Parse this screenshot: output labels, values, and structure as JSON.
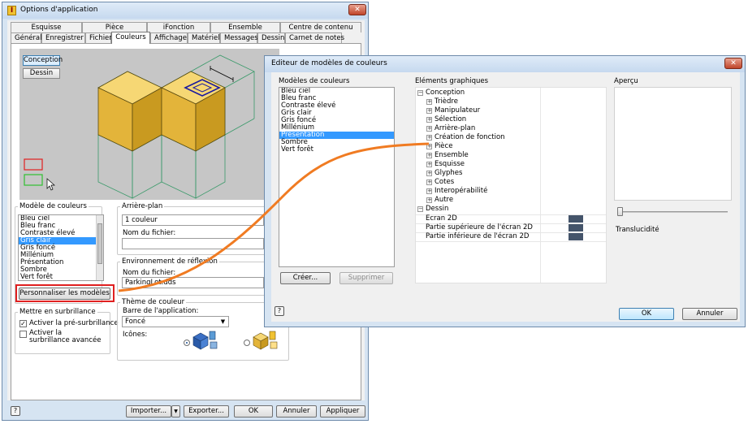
{
  "options": {
    "title": "Options d'application",
    "tabs_row1": [
      "Esquisse",
      "Pièce",
      "iFonction",
      "Ensemble",
      "Centre de contenu"
    ],
    "tabs_row2": [
      "Général",
      "Enregistrer",
      "Fichier",
      "Couleurs",
      "Affichage",
      "Matériel",
      "Messages",
      "Dessin",
      "Carnet de notes"
    ],
    "active_tab": "Couleurs",
    "preview_buttons": [
      "Conception",
      "Dessin"
    ],
    "color_model_label": "Modèle de couleurs",
    "color_models": [
      "Bleu ciel",
      "Bleu franc",
      "Contraste élevé",
      "Gris clair",
      "Gris foncé",
      "Millénium",
      "Présentation",
      "Sombre",
      "Vert forêt"
    ],
    "selected_model": "Gris clair",
    "customize_button": "Personnaliser les modèles",
    "background_label": "Arrière-plan",
    "background_value": "1 couleur",
    "file_name_label": "Nom du fichier:",
    "reflection_label": "Environnement de réflexion",
    "reflection_file_label": "Nom du fichier:",
    "reflection_value": "ParkingLot.dds",
    "highlight_label": "Mettre en surbrillance",
    "prehighlight_label": "Activer la pré-surbrillance",
    "advanced_highlight_label": "Activer la surbrillance avancée",
    "theme_label": "Thème de couleur",
    "app_bar_label": "Barre de l'application:",
    "app_bar_value": "Foncé",
    "icons_label": "Icônes:",
    "import_button": "Importer...",
    "export_button": "Exporter...",
    "ok_button": "OK",
    "cancel_button": "Annuler",
    "apply_button": "Appliquer"
  },
  "editor": {
    "title": "Editeur de modèles de couleurs",
    "models_label": "Modèles de couleurs",
    "models": [
      "Bleu ciel",
      "Bleu franc",
      "Contraste élevé",
      "Gris clair",
      "Gris foncé",
      "Millénium",
      "Présentation",
      "Sombre",
      "Vert forêt"
    ],
    "selected_model": "Présentation",
    "elements_label": "Eléments graphiques",
    "tree_conception": "Conception",
    "tree_children": [
      "Trièdre",
      "Manipulateur",
      "Sélection",
      "Arrière-plan",
      "Création de fonction",
      "Pièce",
      "Ensemble",
      "Esquisse",
      "Glyphes",
      "Cotes",
      "Interopérabilité",
      "Autre"
    ],
    "tree_dessin": "Dessin",
    "dessin_rows": [
      "Ecran 2D",
      "Partie supérieure de l'écran 2D",
      "Partie inférieure de l'écran 2D"
    ],
    "swatch_color": "#44546a",
    "preview_label": "Aperçu",
    "translucency_label": "Translucidité",
    "create_button": "Créer...",
    "delete_button": "Supprimer",
    "ok_button": "OK",
    "cancel_button": "Annuler"
  },
  "colors": {
    "cube_yellow": "#f1c232",
    "connector_orange": "#f07b22",
    "selection_blue": "#3399ff"
  }
}
